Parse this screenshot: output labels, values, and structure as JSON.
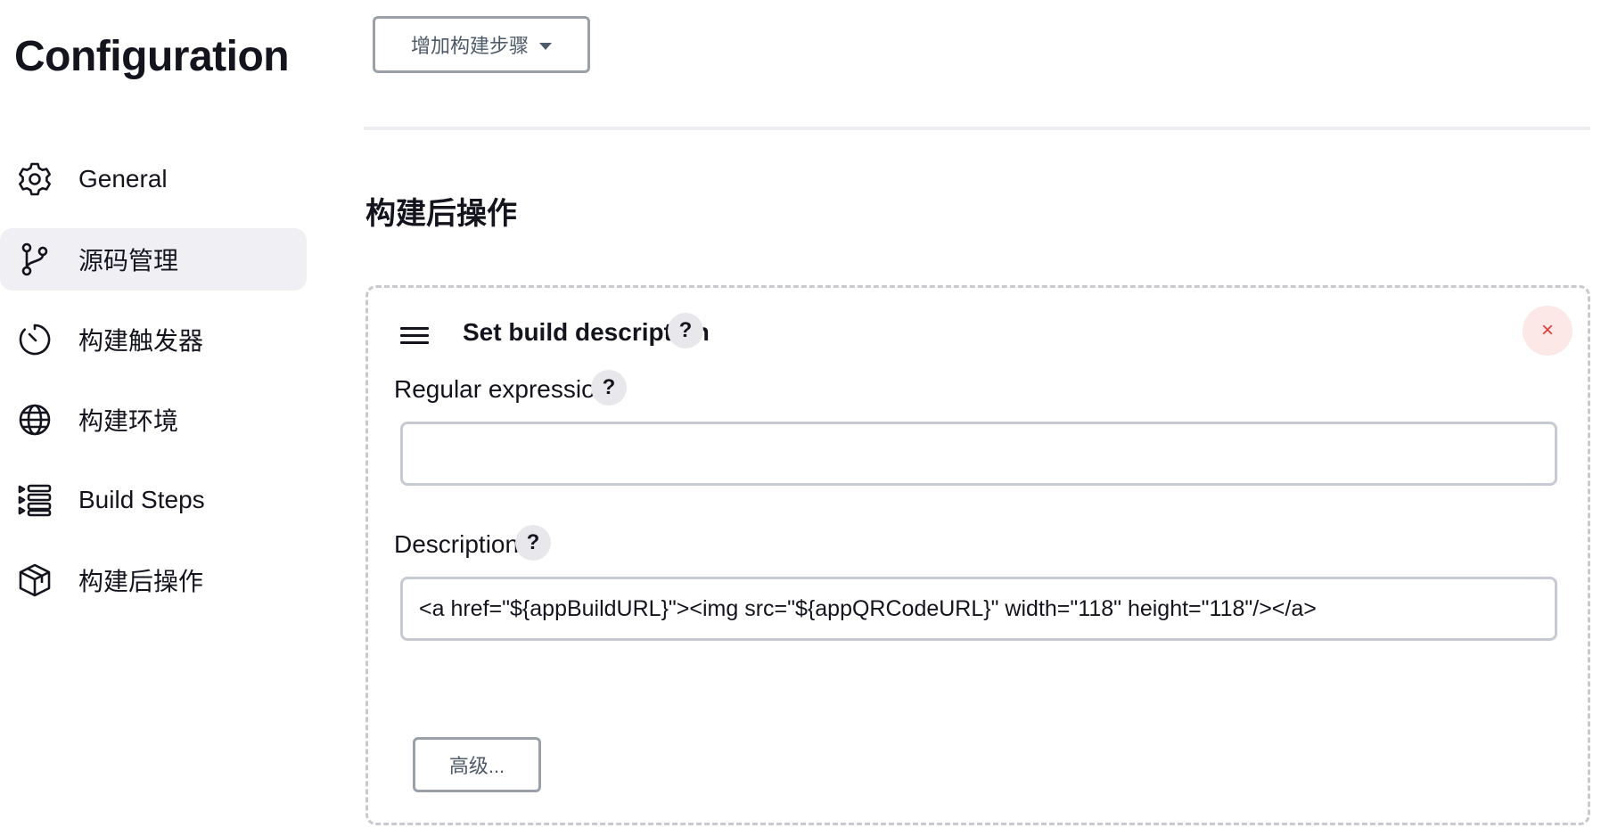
{
  "page": {
    "title": "Configuration"
  },
  "sidebar": {
    "items": [
      {
        "label": "General",
        "icon": "gear-icon",
        "active": false
      },
      {
        "label": "源码管理",
        "icon": "branch-icon",
        "active": true
      },
      {
        "label": "构建触发器",
        "icon": "timer-icon",
        "active": false
      },
      {
        "label": "构建环境",
        "icon": "globe-icon",
        "active": false
      },
      {
        "label": "Build Steps",
        "icon": "list-icon",
        "active": false
      },
      {
        "label": "构建后操作",
        "icon": "package-icon",
        "active": false
      }
    ]
  },
  "main": {
    "add_step_label": "增加构建步骤",
    "section_title": "构建后操作",
    "step": {
      "title": "Set build description",
      "help": "?",
      "close": "×",
      "fields": {
        "regex": {
          "label": "Regular expression",
          "value": ""
        },
        "description": {
          "label": "Description",
          "value": "<a href=\"${appBuildURL}\"><img src=\"${appQRCodeURL}\" width=\"118\" height=\"118\"/></a>"
        }
      },
      "advanced_label": "高级..."
    }
  }
}
